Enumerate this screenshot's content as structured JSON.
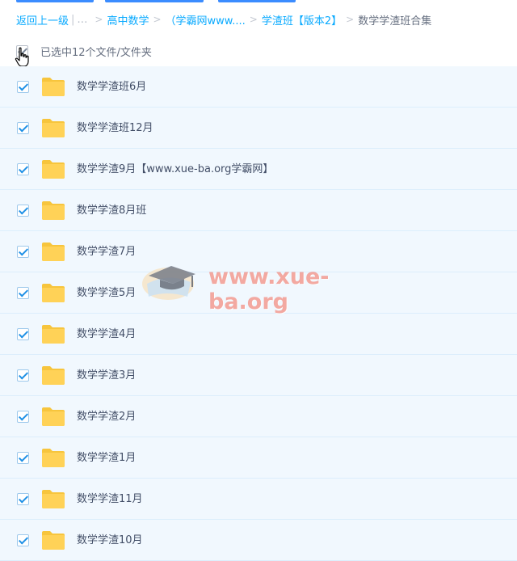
{
  "breadcrumb": {
    "back": "返回上一级",
    "ellipsis": "…",
    "sep": ">",
    "items": [
      "高中数学",
      "（学霸网www....",
      "学渣班【版本2】"
    ],
    "current": "数学学渣班合集"
  },
  "selection": {
    "text": "已选中12个文件/文件夹"
  },
  "files": [
    {
      "name": "数学学渣班6月"
    },
    {
      "name": "数学学渣班12月"
    },
    {
      "name": "数学学渣9月【www.xue-ba.org学霸网】"
    },
    {
      "name": "数学学渣8月班"
    },
    {
      "name": "数学学渣7月"
    },
    {
      "name": "数学学渣5月"
    },
    {
      "name": "数学学渣4月"
    },
    {
      "name": "数学学渣3月"
    },
    {
      "name": "数学学渣2月"
    },
    {
      "name": "数学学渣1月"
    },
    {
      "name": "数学学渣11月"
    },
    {
      "name": "数学学渣10月"
    }
  ],
  "watermark": {
    "text": "www.xue-ba.org"
  },
  "colors": {
    "link": "#09aaff",
    "row_bg": "#f1f8fe",
    "folder": "#ffd257",
    "check": "#1e90e6"
  },
  "icons": {
    "folder": "folder-icon",
    "checkbox": "checkbox-icon",
    "cursor": "hand-cursor-icon",
    "watermark_logo": "graduation-cap-icon"
  }
}
